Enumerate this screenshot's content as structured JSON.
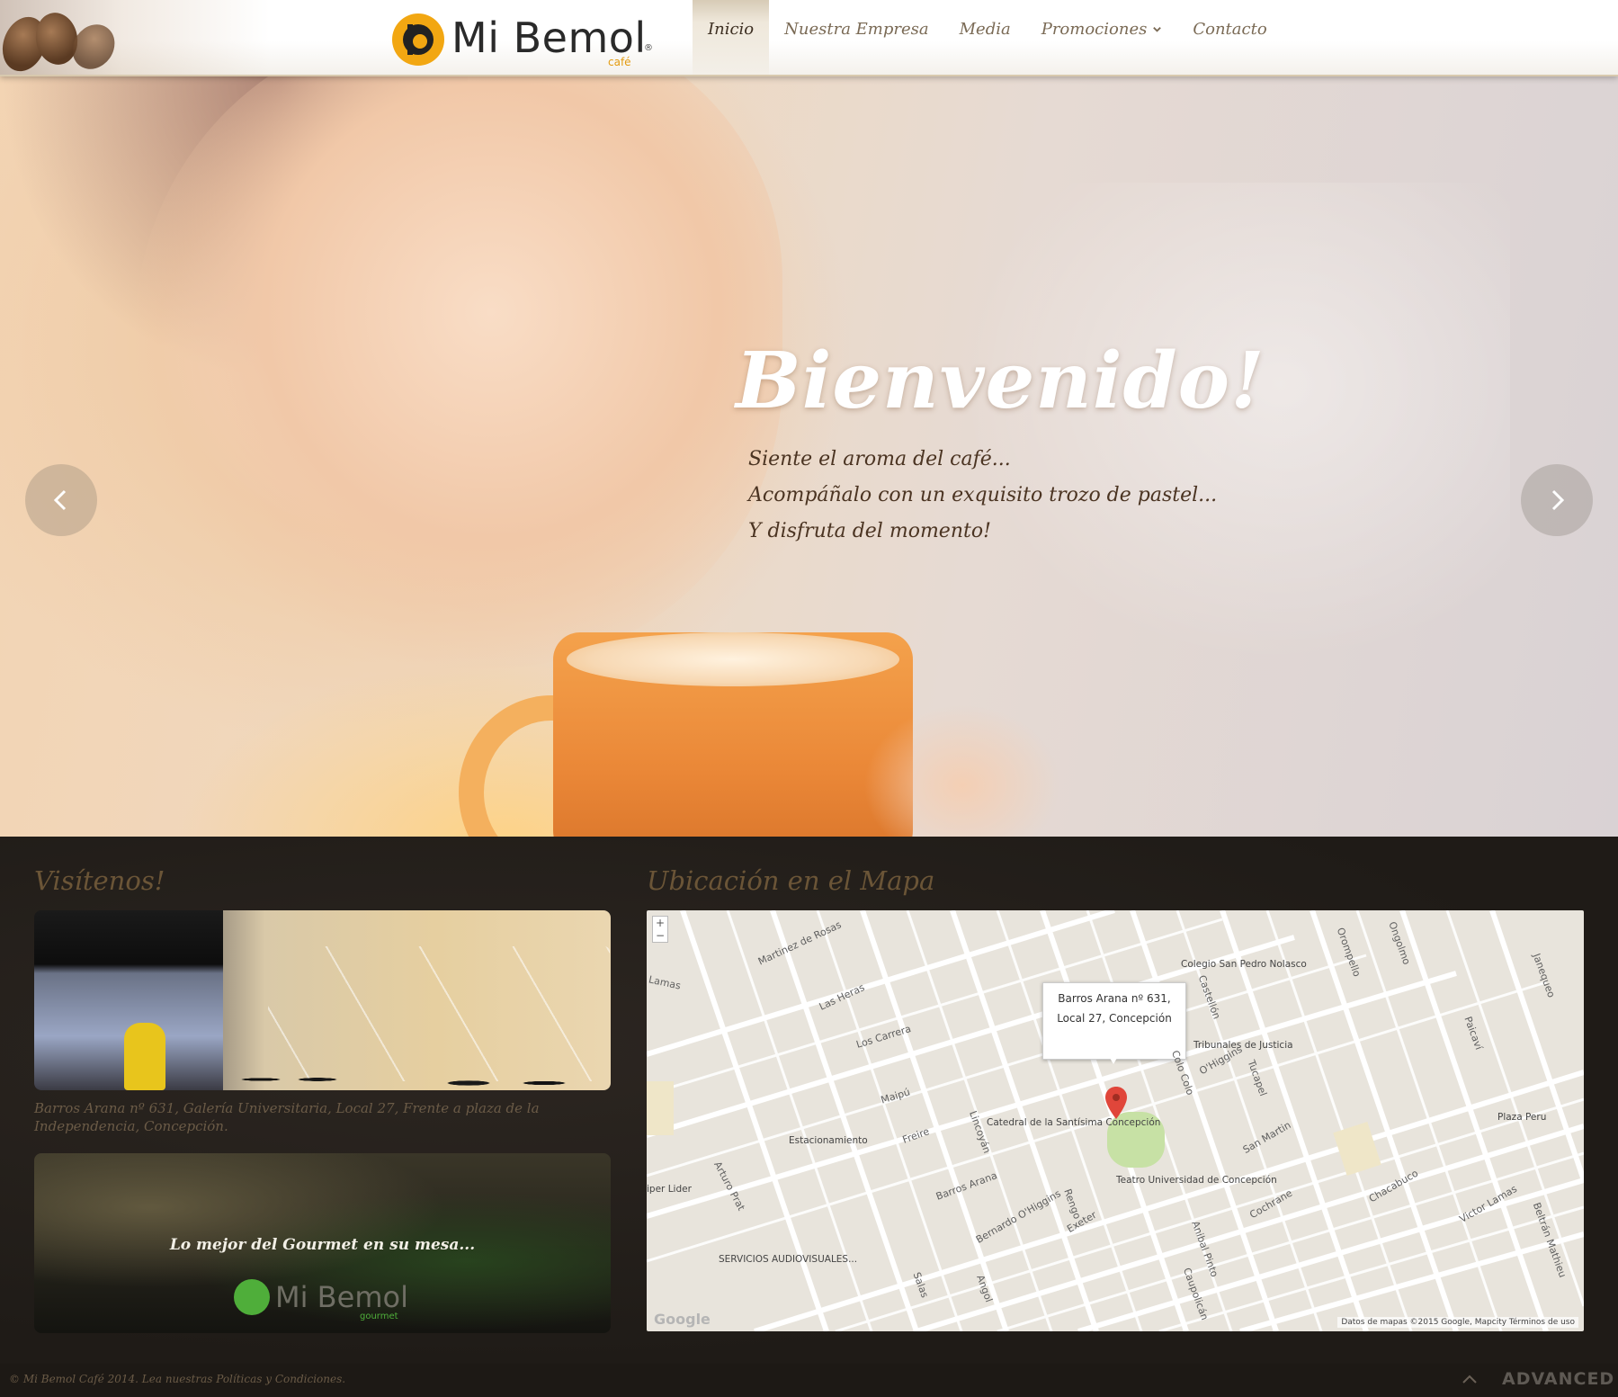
{
  "header": {
    "logo_text": "Mi Bemol",
    "logo_sub": "café",
    "logo_reg": "®",
    "nav": [
      {
        "label": "Inicio",
        "active": true
      },
      {
        "label": "Nuestra Empresa",
        "active": false
      },
      {
        "label": "Media",
        "active": false
      },
      {
        "label": "Promociones",
        "active": false,
        "has_dropdown": true
      },
      {
        "label": "Contacto",
        "active": false
      }
    ]
  },
  "hero": {
    "title": "Bienvenido!",
    "lines": [
      "Siente el aroma del café...",
      "Acompáñalo con un exquisito trozo de pastel...",
      "Y disfruta del momento!"
    ],
    "prev_icon": "chevron-left-icon",
    "next_icon": "chevron-right-icon"
  },
  "visit": {
    "heading": "Visítenos!",
    "caption": "Barros Arana nº 631, Galería Universitaria, Local 27, Frente a plaza de la Independencia, Concepción.",
    "gourmet_text": "Lo mejor del Gourmet en su mesa...",
    "gourmet_logo": "Mi Bemol",
    "gourmet_sub": "gourmet"
  },
  "map": {
    "heading": "Ubicación en el Mapa",
    "infobox_line1": "Barros Arana nº 631,",
    "infobox_line2": "Local 27, Concepción",
    "zoom_in": "+",
    "zoom_out": "−",
    "google": "Google",
    "attribution": "Datos de mapas ©2015 Google, Mapcity    Términos de uso",
    "places": [
      "Colegio San Pedro Nolasco",
      "Tribunales de Justicia",
      "Catedral de la Santísima Concepción",
      "Teatro Universidad de Concepción",
      "Estacionamiento",
      "Plaza Peru",
      "SERVICIOS AUDIOVISUALES...",
      "iper Lider"
    ],
    "streets": [
      "Los Carrera",
      "Maipú",
      "Martinez de Rosas",
      "Las Heras",
      "Lamas",
      "Barros Arana",
      "Freire",
      "Lincoyán",
      "Rengo",
      "Salas",
      "Angol",
      "Arturo Prat",
      "Castellón",
      "Colo Colo",
      "Anibal Pinto",
      "Cochrane",
      "Chacabuco",
      "San Martin",
      "O'Higgins",
      "Bernardo O'Higgins",
      "Orompello",
      "Ongolmo",
      "Tucapel",
      "Paicaví",
      "Victor Lamas",
      "Janequeo",
      "Exeter",
      "Caupolicán",
      "Beltrán Mathieu"
    ]
  },
  "footer": {
    "copyright": "© Mi Bemol Café 2014. Lea nuestras Políticas y Condiciones.",
    "brand": "ADVANCED"
  }
}
